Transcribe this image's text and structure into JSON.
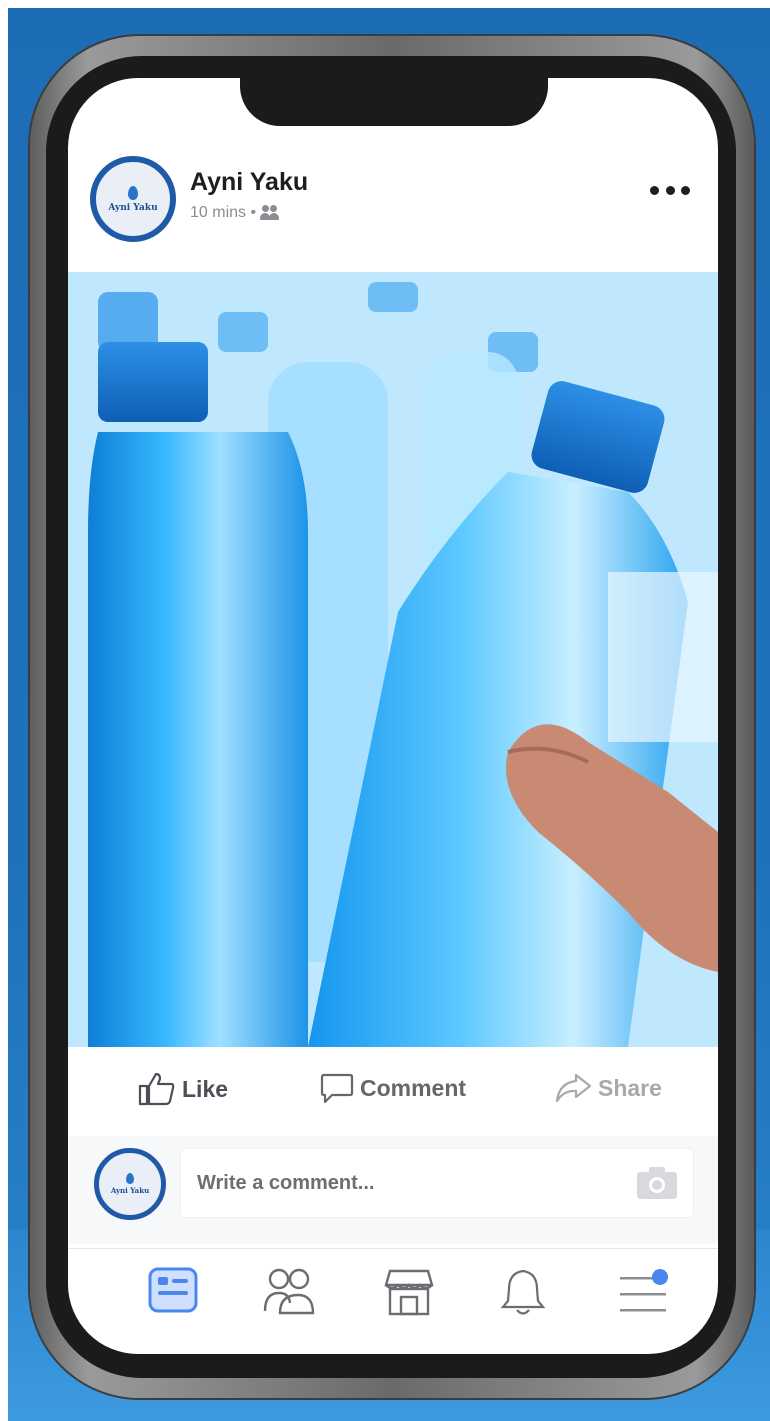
{
  "post": {
    "page_name": "Ayni Yaku",
    "avatar_text": "Ayni Yaku",
    "time": "10 mins •",
    "audience_icon": "friends-icon",
    "more_icon": "more-icon"
  },
  "photo": {
    "subject_icon": "water-bottles-photo"
  },
  "actions": {
    "like_label": "Like",
    "comment_label": "Comment",
    "share_label": "Share"
  },
  "comment_box": {
    "placeholder": "Write a comment...",
    "camera_icon": "camera-icon"
  },
  "tab_bar": {
    "items": [
      "news-feed-icon",
      "friends-icon",
      "marketplace-icon",
      "notifications-icon",
      "menu-icon"
    ],
    "active": "news-feed-icon"
  },
  "colors": {
    "background_blue": "#1f72ba",
    "brand_blue": "#1f5aa8",
    "active_tab": "#4a86f0"
  }
}
